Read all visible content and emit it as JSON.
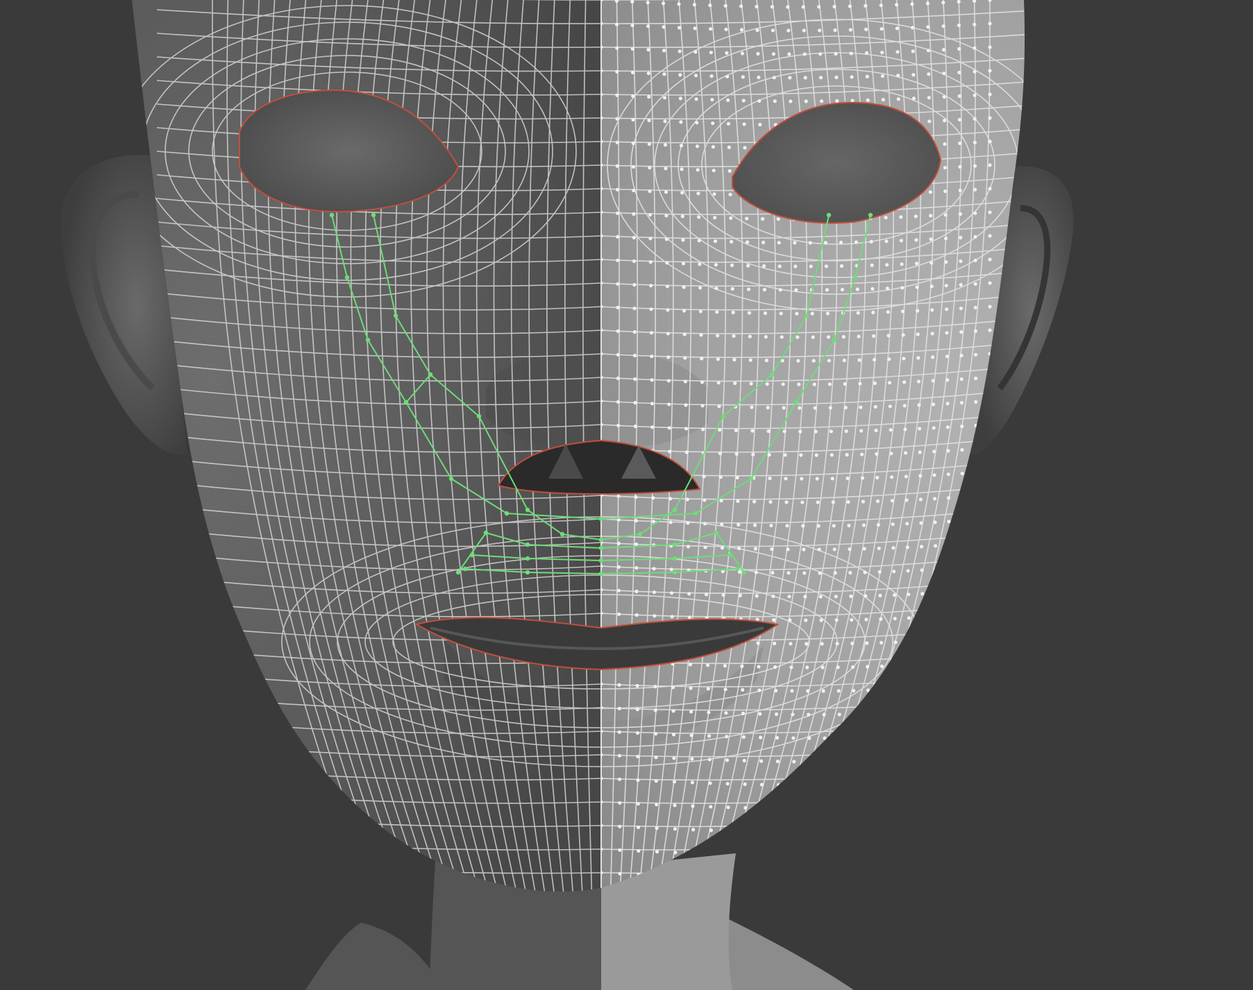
{
  "viewport": {
    "background": "#3a3a3a",
    "subject": "head-mesh"
  },
  "colors": {
    "background": "#3a3a3a",
    "shaded_side": "#5c5c5c",
    "lit_side": "#a3a3a3",
    "wire": "#d8d8d8",
    "vertex": "#eeeeee",
    "selected_edge_loop": "#6fdc78",
    "border_edge": "#c0503c"
  },
  "symmetry": {
    "mirrored": true,
    "left_half": "shaded",
    "right_half": "lit-with-vertices"
  },
  "selection": {
    "type": "edge-loop",
    "region": "nasolabial-fold",
    "loops_visible": 2
  },
  "open_borders": [
    "left-eye",
    "right-eye",
    "nostrils",
    "mouth"
  ]
}
